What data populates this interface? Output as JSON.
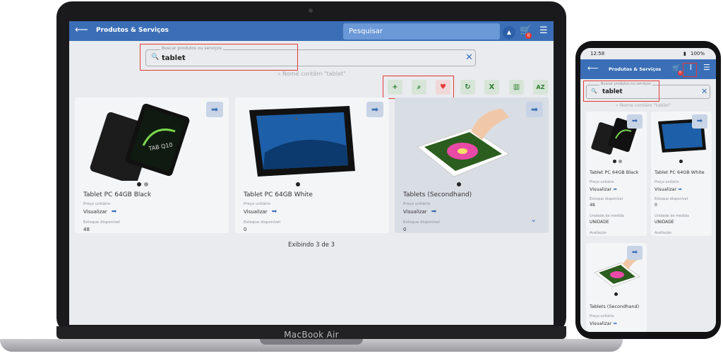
{
  "laptop": {
    "brand": "MacBook Air",
    "appbar": {
      "title": "Produtos & Serviços",
      "search_placeholder": "Pesquisar",
      "cart_count": "0"
    },
    "search": {
      "label": "Buscar produtos ou serviços",
      "value": "tablet",
      "hint": "Nome contém \"tablet\""
    },
    "toolbar": {
      "add": "+",
      "search": "⌕",
      "favorite": "♥",
      "refresh": "↻",
      "excel": "X",
      "columns": "▥",
      "sort": "AZ"
    },
    "cards": [
      {
        "title": "Tablet PC 64GB Black",
        "price_label": "Preço unitário",
        "view_label": "Visualizar",
        "stock_label": "Estoque disponível",
        "stock_value": "48"
      },
      {
        "title": "Tablet PC 64GB White",
        "price_label": "Preço unitário",
        "view_label": "Visualizar",
        "stock_label": "Estoque disponível",
        "stock_value": "0"
      },
      {
        "title": "Tablets (Secondhand)",
        "price_label": "Preço unitário",
        "view_label": "Visualizar",
        "stock_label": "Estoque disponível",
        "stock_value": "0"
      }
    ],
    "footer": "Exibindo 3 de 3"
  },
  "phone": {
    "status": {
      "time": "12:58",
      "battery": "100%"
    },
    "appbar": {
      "title": "Produtos & Serviços",
      "cart_count": "0"
    },
    "search": {
      "label": "Buscar produtos ou serviços",
      "value": "tablet",
      "hint": "Nome contém \"tablet\""
    },
    "cards": [
      {
        "title": "Tablet PC 64GB Black",
        "price_label": "Preço unitário",
        "view_label": "Visualizar",
        "stock_label": "Estoque disponível",
        "stock_value": "48",
        "unit_label": "Unidade de medida",
        "unit_value": "UNIDADE",
        "rating_label": "Avaliação"
      },
      {
        "title": "Tablet PC 64GB White",
        "price_label": "Preço unitário",
        "view_label": "Visualizar",
        "stock_label": "Estoque disponível",
        "stock_value": "0",
        "unit_label": "Unidade de medida",
        "unit_value": "UNIDADE",
        "rating_label": "Avaliação"
      },
      {
        "title": "Tablets (Secondhand)",
        "price_label": "Preço unitário",
        "view_label": "Visualizar"
      }
    ]
  },
  "colors": {
    "primary": "#3a6fb7",
    "highlight": "#e53935",
    "background": "#e9ebee"
  }
}
